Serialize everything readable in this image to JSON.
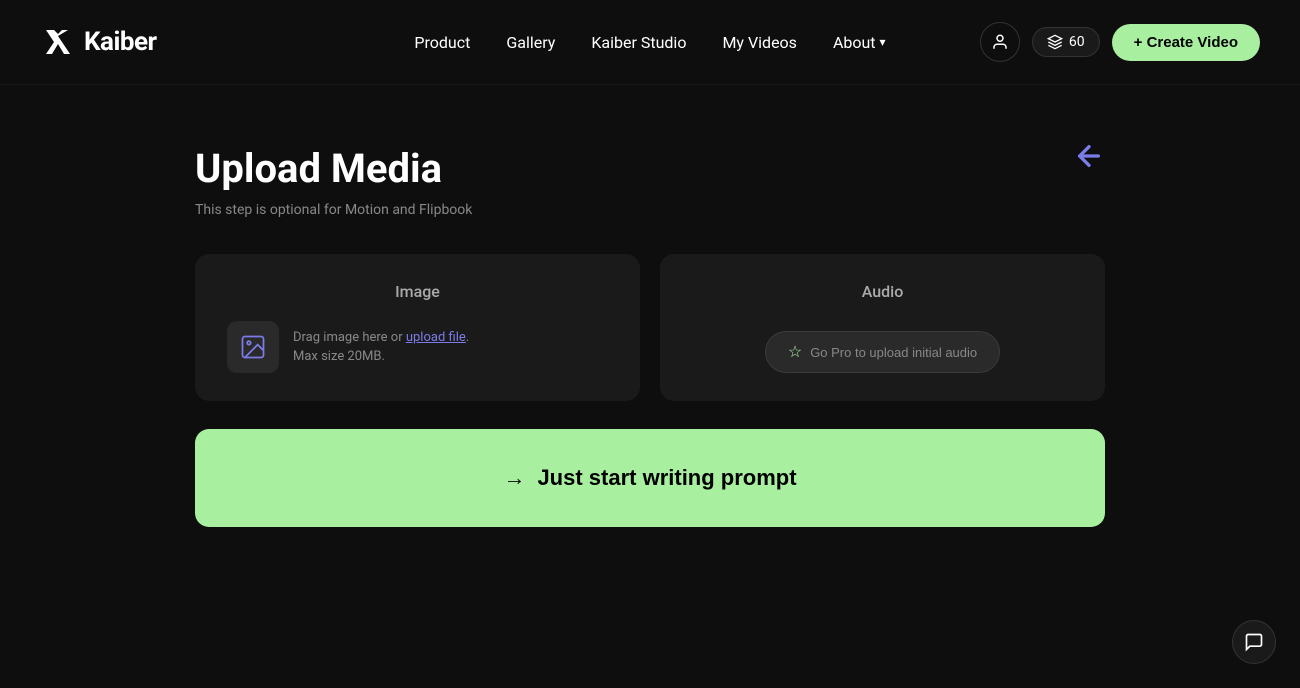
{
  "brand": {
    "name": "Kaiber",
    "logo_alt": "Kaiber logo"
  },
  "navbar": {
    "links": [
      {
        "id": "product",
        "label": "Product"
      },
      {
        "id": "gallery",
        "label": "Gallery"
      },
      {
        "id": "kaiber-studio",
        "label": "Kaiber Studio"
      },
      {
        "id": "my-videos",
        "label": "My Videos"
      },
      {
        "id": "about",
        "label": "About"
      }
    ],
    "credits_count": "60",
    "create_video_label": "+ Create Video"
  },
  "page": {
    "title": "Upload Media",
    "subtitle": "This step is optional for Motion and Flipbook"
  },
  "image_card": {
    "title": "Image",
    "drag_text": "Drag image here or ",
    "link_text": "upload file",
    "drag_suffix": ".",
    "size_text": "Max size 20MB."
  },
  "audio_card": {
    "title": "Audio",
    "go_pro_label": "Go Pro to upload initial audio"
  },
  "prompt_btn": {
    "label": "Just start writing prompt",
    "arrow": "→"
  },
  "colors": {
    "accent_green": "#a8f0a0",
    "accent_purple": "#7b7ce8",
    "bg_dark": "#0e0e0e",
    "card_bg": "#1a1a1a"
  }
}
